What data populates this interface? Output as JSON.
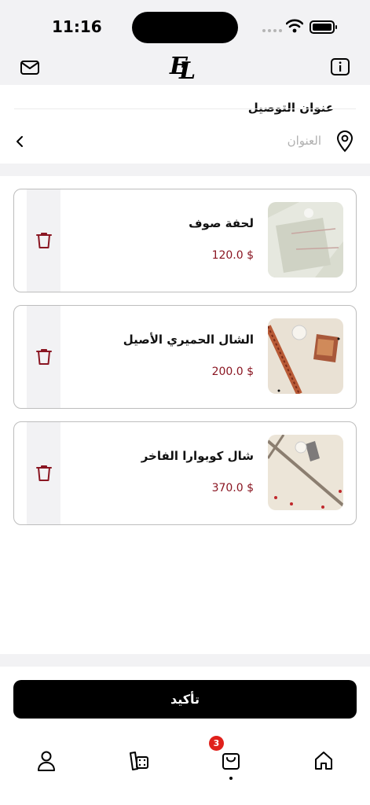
{
  "status_bar": {
    "time": "11:16"
  },
  "header": {
    "logo_text": "EL"
  },
  "address": {
    "title": "عنوان التوصيل",
    "placeholder": "العنوان"
  },
  "cart": {
    "items": [
      {
        "name": "لحفة صوف",
        "price": "120.0 $"
      },
      {
        "name": "الشال الحميري الأصيل",
        "price": "200.0 $"
      },
      {
        "name": "شال كوبوارا الفاخر",
        "price": "370.0 $"
      }
    ]
  },
  "confirm_label": "تأكيد",
  "bottom_nav": {
    "cart_count": "3"
  },
  "colors": {
    "accent": "#8a1622",
    "badge": "#e0201b",
    "background_band": "#f2f2f4"
  },
  "icons": [
    "mail-icon",
    "info-icon",
    "location-pin-icon",
    "chevron-left-icon",
    "trash-icon",
    "user-icon",
    "catalog-icon",
    "shopping-bag-icon",
    "home-icon"
  ]
}
